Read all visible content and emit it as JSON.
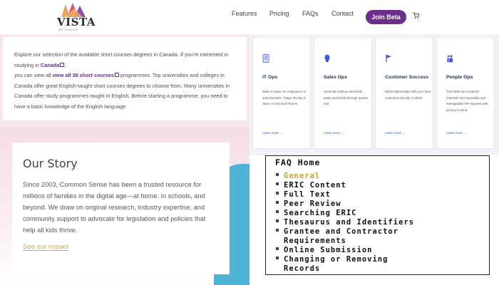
{
  "header": {
    "logo_text": "VISTA",
    "logo_sub": "WP PLUGIN",
    "nav": [
      "Features",
      "Pricing",
      "FAQs",
      "Contact"
    ],
    "cta_label": "Join Beta",
    "cart_icon": "cart-icon",
    "brand_color": "#6c2d8c"
  },
  "intro": {
    "p1": "Explore our selection of the available short courses degrees in Canada. If you're interested in studying in",
    "link_canada": "Canada",
    "p2": ",",
    "p3": "you can view all",
    "link_view_all": "view all 38 short courses",
    "p4": "programmes. Top universities and colleges in Canada offer great English-taught short courses degrees to choose from. Many universities in Canada offer study programmes taught in English. Before starting a programme, you need to have a basic knowledge of the English language."
  },
  "story": {
    "title": "Our Story",
    "text": "Since 2003, Common Sense has been a trusted resource for millions of families in the digital age—at home, in schools, and beyond. We draw on original research, industry expertise, and community support to advocate for legislation and policies that help all kids thrive.",
    "link": "See our impact"
  },
  "cards": [
    {
      "icon": "tablet-icon",
      "title": "IT Ops",
      "desc": "Make it easier for employees to submit tickets. Triage directly in Slack or Microsoft Teams.",
      "link": "Learn more →"
    },
    {
      "icon": "bulb-icon",
      "title": "Sales Ops",
      "desc": "Automate tedious deal desk tasks and assist through quarter-end.",
      "link": "Learn more →"
    },
    {
      "icon": "flag-icon",
      "title": "Customer Success",
      "desc": "Build relationships with your best customers directly in Slack.",
      "link": "Learn more →"
    },
    {
      "icon": "people-icon",
      "title": "People Ops",
      "desc": "Turn DMs and cluttered channels into reportable and manageable HR requests with privacy in mind.",
      "link": "Learn more →"
    }
  ],
  "faq": {
    "title": "FAQ Home",
    "items": [
      {
        "label": "General"
      },
      {
        "label": "ERIC Content"
      },
      {
        "label": "Full Text"
      },
      {
        "label": "Peer Review"
      },
      {
        "label": "Searching ERIC"
      },
      {
        "label": "Thesaurus and Identifiers"
      },
      {
        "label": "Grantee and Contractor"
      },
      {
        "label": "Requirements"
      },
      {
        "label": "Online Submission"
      },
      {
        "label": "Changing or Removing"
      },
      {
        "label": "Records"
      }
    ],
    "active_color": "#c8a02e"
  }
}
